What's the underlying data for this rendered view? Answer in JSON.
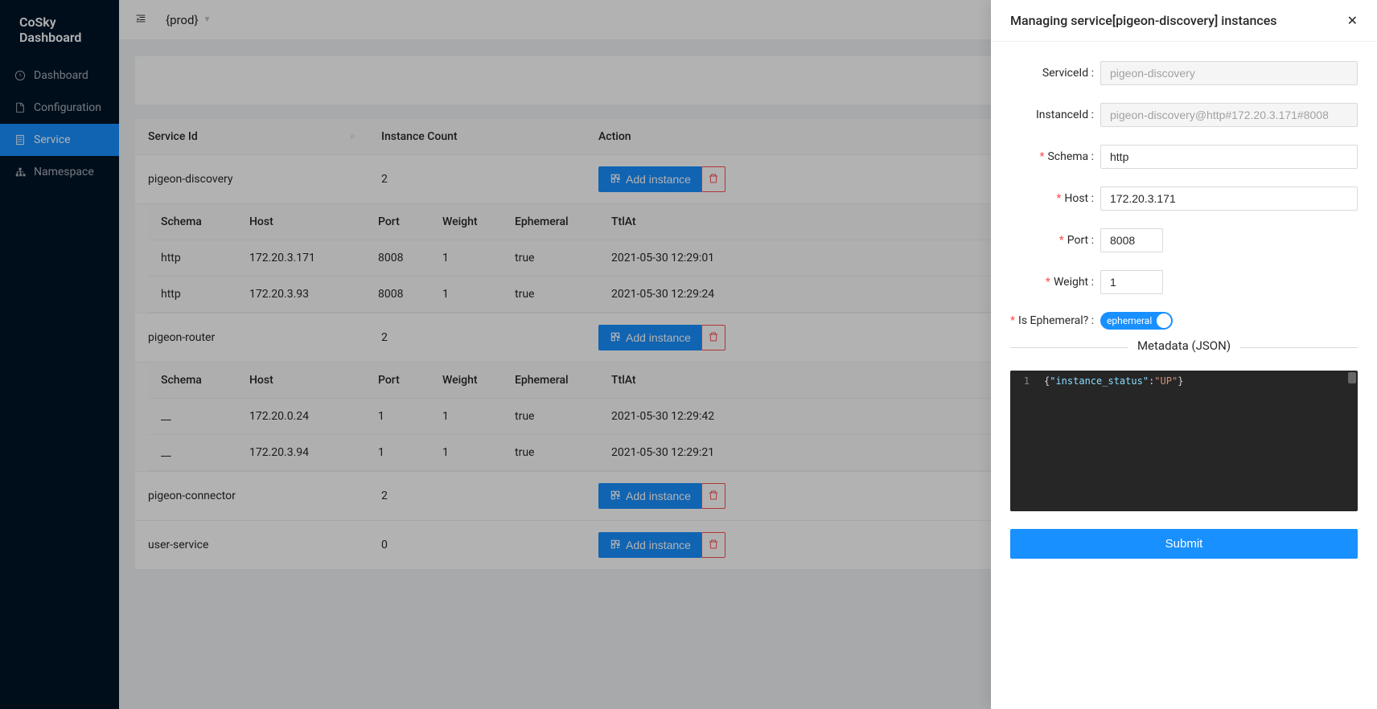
{
  "app": {
    "title": "CoSky Dashboard"
  },
  "sidebar": {
    "items": [
      {
        "label": "Dashboard",
        "icon": "dashboard"
      },
      {
        "label": "Configuration",
        "icon": "file"
      },
      {
        "label": "Service",
        "icon": "database",
        "active": true
      },
      {
        "label": "Namespace",
        "icon": "cluster"
      }
    ]
  },
  "topbar": {
    "namespace": "{prod}"
  },
  "servicesTable": {
    "headers": {
      "serviceId": "Service Id",
      "instanceCount": "Instance Count",
      "action": "Action"
    },
    "addInstanceLabel": "Add instance",
    "rows": [
      {
        "serviceId": "pigeon-discovery",
        "instanceCount": "2"
      },
      {
        "serviceId": "pigeon-router",
        "instanceCount": "2"
      },
      {
        "serviceId": "pigeon-connector",
        "instanceCount": "2"
      },
      {
        "serviceId": "user-service",
        "instanceCount": "0"
      }
    ]
  },
  "instancesTable": {
    "headers": {
      "schema": "Schema",
      "host": "Host",
      "port": "Port",
      "weight": "Weight",
      "ephemeral": "Ephemeral",
      "ttlAt": "TtlAt"
    },
    "groups": [
      {
        "rows": [
          {
            "schema": "http",
            "host": "172.20.3.171",
            "port": "8008",
            "weight": "1",
            "ephemeral": "true",
            "ttlAt": "2021-05-30 12:29:01"
          },
          {
            "schema": "http",
            "host": "172.20.3.93",
            "port": "8008",
            "weight": "1",
            "ephemeral": "true",
            "ttlAt": "2021-05-30 12:29:24"
          }
        ]
      },
      {
        "rows": [
          {
            "schema": "__",
            "host": "172.20.0.24",
            "port": "1",
            "weight": "1",
            "ephemeral": "true",
            "ttlAt": "2021-05-30 12:29:42"
          },
          {
            "schema": "__",
            "host": "172.20.3.94",
            "port": "1",
            "weight": "1",
            "ephemeral": "true",
            "ttlAt": "2021-05-30 12:29:21"
          }
        ]
      }
    ]
  },
  "drawer": {
    "title": "Managing service[pigeon-discovery] instances",
    "labels": {
      "serviceId": "ServiceId :",
      "instanceId": "InstanceId :",
      "schema": "Schema :",
      "host": "Host :",
      "port": "Port :",
      "weight": "Weight :",
      "ephemeral": "Is Ephemeral? :",
      "metadata": "Metadata (JSON)",
      "submit": "Submit",
      "switchOn": "ephemeral"
    },
    "values": {
      "serviceId": "pigeon-discovery",
      "instanceId": "pigeon-discovery@http#172.20.3.171#8008",
      "schema": "http",
      "host": "172.20.3.171",
      "port": "8008",
      "weight": "1"
    },
    "metadataCode": {
      "lineNo": "1",
      "key": "\"instance_status\"",
      "val": "\"UP\""
    }
  }
}
